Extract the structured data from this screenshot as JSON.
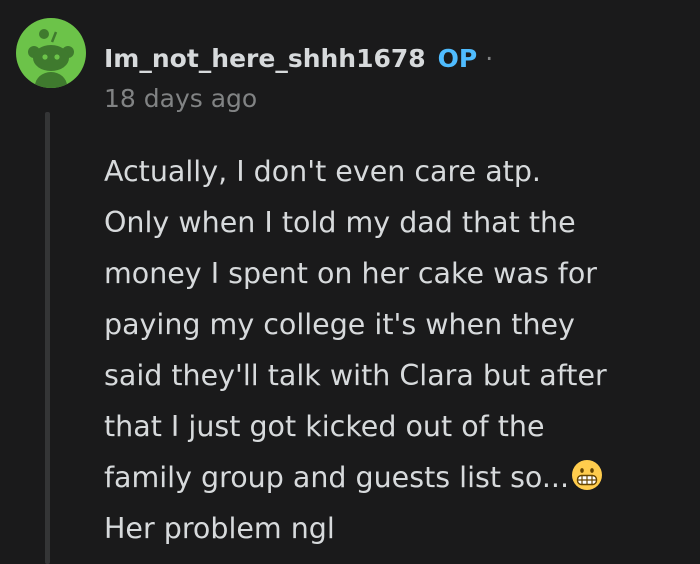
{
  "comment": {
    "author": "Im_not_here_shhh1678",
    "op_label": "OP",
    "separator": "·",
    "timestamp": "18 days ago",
    "body_lines": [
      "Actually, I don't even care atp.",
      "Only when I told my dad that the",
      "money I spent on her cake was for",
      "paying my college it's when they",
      "said they'll talk with Clara but after",
      "that I just got kicked out of the",
      "family group and guests list so...",
      "Her problem ngl"
    ],
    "emoji": "grimacing-face-emoji"
  },
  "colors": {
    "background": "#1a1a1b",
    "text": "#d7dadc",
    "muted": "#818384",
    "op_blue": "#4fbcff",
    "avatar_green": "#6cc349",
    "thread_line": "#343536"
  }
}
